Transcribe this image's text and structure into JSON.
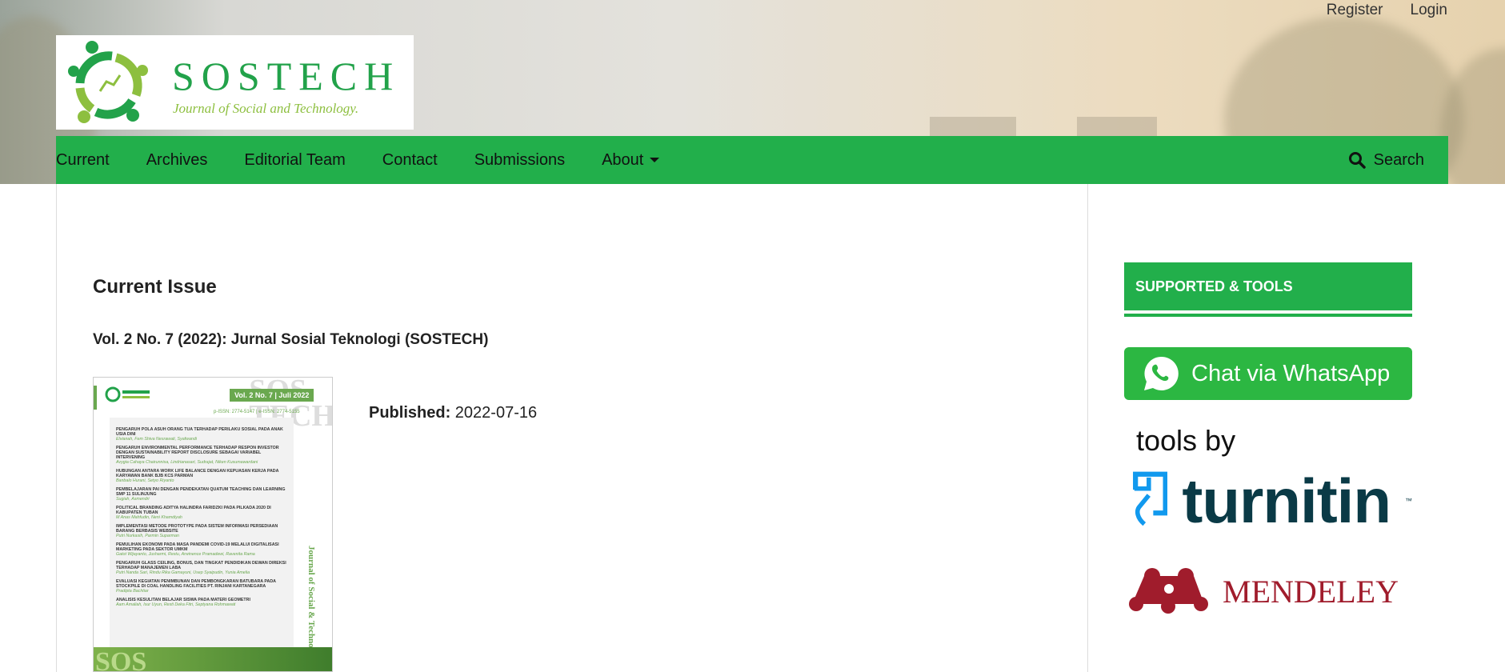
{
  "header": {
    "register": "Register",
    "login": "Login"
  },
  "logo": {
    "name": "SOSTECH",
    "tagline": "Journal of Social and Technology."
  },
  "nav": {
    "items": [
      "Current",
      "Archives",
      "Editorial Team",
      "Contact",
      "Submissions",
      "About"
    ],
    "search": "Search"
  },
  "main": {
    "title": "Current Issue",
    "issue": "Vol. 2 No. 7 (2022): Jurnal Sosial Teknologi (SOSTECH)",
    "published_label": "Published:",
    "published_value": "2022-07-16",
    "cover": {
      "vol": "Vol. 2 No. 7 | Juli 2022",
      "issn": "p-ISSN: 2774-5147 | e-ISSN: 2774-5155",
      "vertical": "Journal of Social & Technology",
      "articles": [
        {
          "t": "PENGARUH POLA ASUH ORANG TUA TERHADAP PERILAKU SOSIAL PADA ANAK USIA DINI",
          "a": "Elvianah, Fem Shiva Nesrawati, Syafwandi"
        },
        {
          "t": "PENGARUH ENVIRONMENTAL PERFORMANCE TERHADAP RESPON INVESTOR DENGAN SUSTAINABILITY REPORT DISCLOSURE SEBAGAI VARIABEL INTERVENING",
          "a": "Avygia Cahaya Chairunnisa, Lindrianasari, Sudrajat, Niken Kusumawardani"
        },
        {
          "t": "HUBUNGAN ANTARA WORK LIFE BALANCE DENGAN KEPUASAN KERJA PADA KARYAWAN BANK BJB KCS PARMAN",
          "a": "Banbalo Hurani, Setyo Riyanto"
        },
        {
          "t": "PEMBELAJARAN PAI DENGAN PENDEKATAN QUATUM TEACHING DAN LEARNING SMP 11 SULINJUNG",
          "a": "Sugiah, Asmendri"
        },
        {
          "t": "POLITICAL BRANDING ADITYA HALINDRA FARIDZKI PADA PILKADA 2020 DI KABUPATEN TUBAN",
          "a": "M Anas Mahfudin, Neni Khamdiyah"
        },
        {
          "t": "IMPLEMENTASI METODE PROTOTYPE PADA SISTEM INFORMASI PERSEDIAAN BARANG BERBASIS WEBSITE",
          "a": "Putri Nurkasih, Parmin Suparman"
        },
        {
          "t": "PEMULIHAN EKONOMI PADA MASA PANDEMI COVID-19 MELALUI DIGITALISASI MARKETING PADA SEKTOR UMKM",
          "a": "Gatot Wijayanto, Jusharmi, Restu, Arwinence Pramadewi, Ravenita Rama"
        },
        {
          "t": "PENGARUH GLASS CEILING, BONUS, DAN TINGKAT PENDIDIKAN DEWAN DIREKSI TERHADAP MANAJEMEN LABA",
          "a": "Putri Nanda Sari, Rindu Rika Gamayuni, Usep Syaipudin, Yunia Amelia"
        },
        {
          "t": "EVALUASI KEGIATAN PENIMBUNAN DAN PEMBONGKARAN BATUBARA PADA STOCKPILE DI COAL HANDLING FACILITIES PT. RINJANI KARTANEGARA",
          "a": "Pradipta Bachtiar"
        },
        {
          "t": "ANALISIS KESULITAN BELAJAR SISWA PADA MATERI GEOMETRI",
          "a": "Aam Amaliah, Isur Uyun, Resti Deka Fitri, Septyana Rohmawati"
        }
      ]
    }
  },
  "sidebar": {
    "heading": "SUPPORTED & TOOLS",
    "whatsapp": "Chat via WhatsApp",
    "tools_by": "tools by",
    "turnitin": "turnitin",
    "tm": "™",
    "mendeley": "MENDELEY"
  },
  "colors": {
    "accent": "#22af4b",
    "mendeley": "#a01c2c",
    "turnitin": "#0a3a46"
  }
}
